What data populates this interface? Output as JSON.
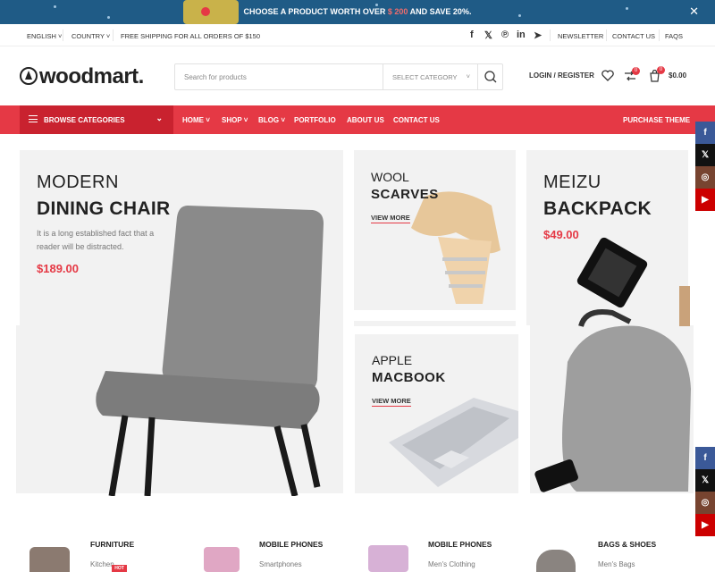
{
  "promo": {
    "prefix": "CHOOSE A PRODUCT WORTH OVER ",
    "amount": "$ 200",
    "suffix": " AND SAVE 20%.",
    "close": "✕"
  },
  "topbar": {
    "language": "ENGLISH",
    "country": "COUNTRY",
    "shipping": "FREE SHIPPING FOR ALL ORDERS OF $150",
    "social": [
      "f",
      "𝕏",
      "℗",
      "in",
      "➤"
    ],
    "links": [
      "NEWSLETTER",
      "CONTACT US",
      "FAQS"
    ]
  },
  "header": {
    "logo": "woodmart.",
    "search_placeholder": "Search for products",
    "select_category": "SELECT CATEGORY",
    "login": "LOGIN / REGISTER",
    "compare_count": "0",
    "cart_count": "0",
    "cart_total": "$0.00"
  },
  "nav": {
    "browse": "BROWSE CATEGORIES",
    "items": [
      "HOME",
      "SHOP",
      "BLOG",
      "PORTFOLIO",
      "ABOUT US",
      "CONTACT US"
    ],
    "purchase": "PURCHASE THEME"
  },
  "floating_social": [
    "f",
    "𝕏",
    "◎",
    "▶"
  ],
  "banners": {
    "chair": {
      "subtitle": "MODERN",
      "title": "DINING CHAIR",
      "desc1": "It is a long established fact that a",
      "desc2": "reader will be distracted.",
      "price": "$189.00"
    },
    "scarves": {
      "subtitle": "WOOL",
      "title": "SCARVES",
      "link": "VIEW MORE"
    },
    "backpack": {
      "subtitle": "MEIZU",
      "title": "BACKPACK",
      "price": "$49.00"
    },
    "macbook": {
      "subtitle": "APPLE",
      "title": "MACBOOK",
      "link": "VIEW MORE"
    }
  },
  "categories": [
    {
      "name": "FURNITURE",
      "sub": "Kitchen",
      "badge": "HOT"
    },
    {
      "name": "MOBILE PHONES",
      "sub": "Smartphones"
    },
    {
      "name": "MOBILE PHONES",
      "sub": "Men's Clothing"
    },
    {
      "name": "BAGS & SHOES",
      "sub": "Men's Bags"
    }
  ],
  "colors": {
    "accent": "#e53945",
    "accent_dark": "#c9222f",
    "promo_bg": "#1f5b86",
    "facebook": "#3b5998",
    "x": "#111111",
    "instagram": "#774430",
    "youtube": "#cc0000"
  }
}
